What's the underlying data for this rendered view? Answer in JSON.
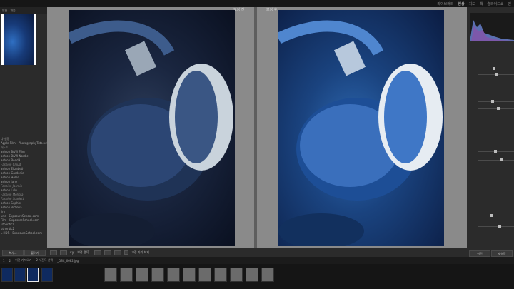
{
  "topbar": {
    "modules": [
      "라이브러리",
      "현상",
      "지도",
      "책",
      "슬라이드쇼",
      "인"
    ],
    "active": "현상"
  },
  "navigator": {
    "tabs": [
      "맞춤",
      "채움"
    ]
  },
  "presets": [
    "나 설정",
    "Apple Film - PhotographyTuts.net",
    "터 - 1",
    "ashion B&W Film",
    "ashion B&W Nordic",
    "ashion Bond9",
    "Fashion Cloud",
    "ashion Elizabeth",
    "ashion Gardenia",
    "ashion Helen",
    "ashion Jane",
    "Fashion Jasmin",
    "ashion Lulu",
    "Fashion Melissa",
    "Fashion Scarlett",
    "ashion Sophie",
    "ashion Victoria",
    "ilm",
    "une - ExposureSchool.com",
    "Film - ExposureSchool.com",
    "uthentic1",
    "uthentic2",
    "L HDR - ExposureSchool.com"
  ],
  "left_buttons": [
    "복사...",
    "붙이기"
  ],
  "compare": {
    "before_label": "보정 전",
    "after_label": "보정 후"
  },
  "toolbar": {
    "view_label": "Y|Y",
    "before_after": "보정 전/후 :",
    "softproof": "교정 미리 보기"
  },
  "right_buttons": [
    "이전",
    "재설정"
  ],
  "filmstrip": {
    "bar_text": [
      "1",
      "2",
      "이전 가져오기",
      "2 사진/1 선택",
      "_DSC_6682.jpg"
    ]
  },
  "colors": {
    "accent": "#e4e4e4",
    "panel": "#2b2b2b",
    "canvas": "#8a8a8a"
  }
}
